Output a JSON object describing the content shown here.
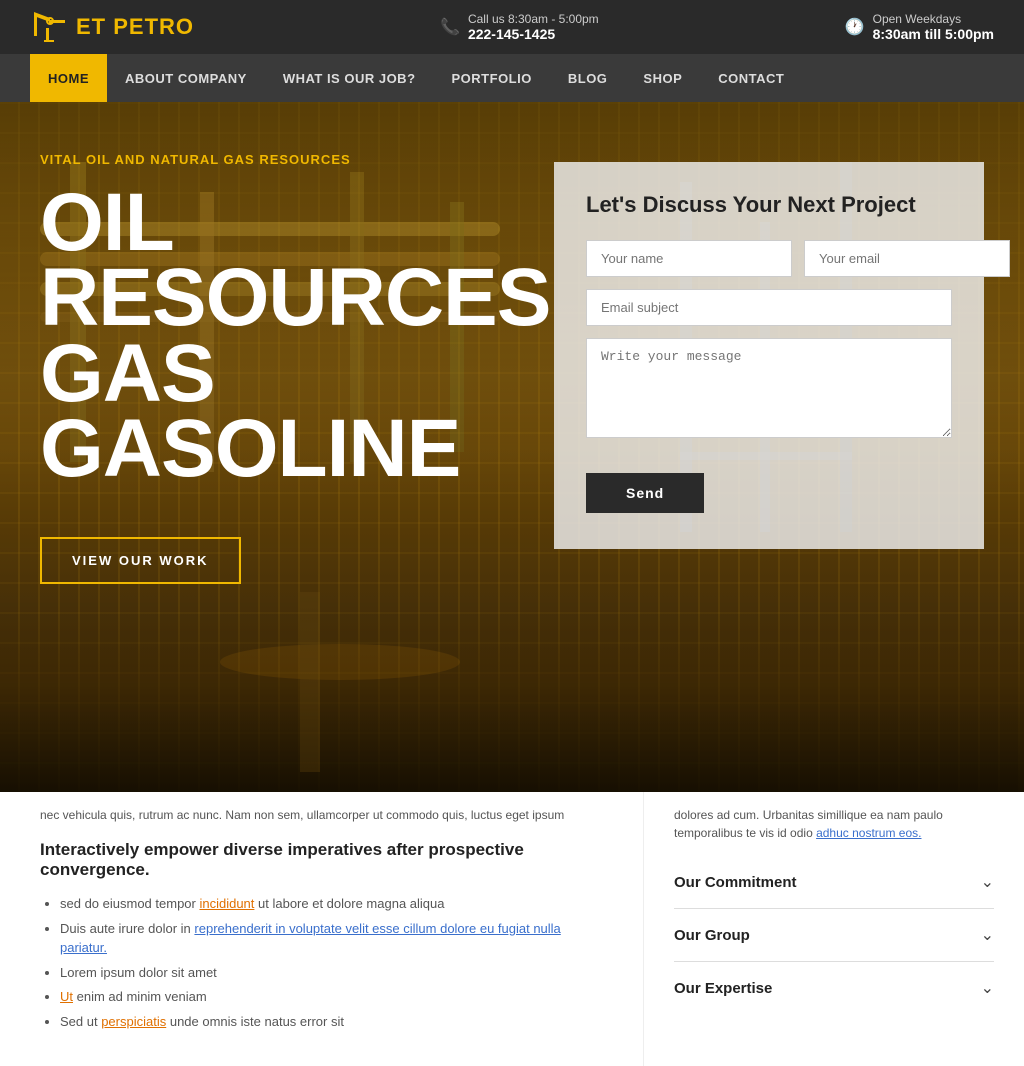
{
  "topbar": {
    "logo_prefix": "ET ",
    "logo_suffix": "PETRO",
    "call_label": "Call us 8:30am - 5:00pm",
    "phone": "222-145-1425",
    "hours_label": "Open Weekdays",
    "hours": "8:30am till 5:00pm"
  },
  "nav": {
    "items": [
      {
        "label": "HOME",
        "active": true
      },
      {
        "label": "ABOUT COMPANY",
        "active": false
      },
      {
        "label": "WHAT IS OUR JOB?",
        "active": false
      },
      {
        "label": "PORTFOLIO",
        "active": false
      },
      {
        "label": "BLOG",
        "active": false
      },
      {
        "label": "SHOP",
        "active": false
      },
      {
        "label": "CONTACT",
        "active": false
      }
    ]
  },
  "hero": {
    "subtitle": "VITAL OIL AND NATURAL GAS RESOURCES",
    "title_line1": "OIL",
    "title_line2": "RESOURCES",
    "title_line3": "GAS",
    "title_line4": "GASOLINE",
    "cta_label": "VIEW OUR WORK"
  },
  "contact_form": {
    "title": "Let's Discuss Your Next Project",
    "name_placeholder": "Your name",
    "email_placeholder": "Your email",
    "subject_placeholder": "Email subject",
    "message_placeholder": "Write your message",
    "send_label": "Send"
  },
  "lower_left": {
    "scroll_text": "nec vehicula quis, rutrum ac nunc. Nam non sem, ullamcorper ut commodo quis, luctus eget ipsum",
    "empower_heading": "Interactively empower diverse imperatives after prospective convergence.",
    "bullets": [
      {
        "text": "sed do eiusmod tempor incididunt ut labore et dolore magna aliqua",
        "highlight_word": "incididunt"
      },
      {
        "text": "Duis aute irure dolor in reprehenderit in voluptate velit esse cillum dolore eu fugiat nulla pariatur.",
        "highlight_words": [
          "reprehenderit",
          "in",
          "voluptate",
          "velit",
          "esse",
          "cillum",
          "dolore",
          "eu",
          "fugiat",
          "nulla",
          "pariatur"
        ]
      },
      {
        "text": "Lorem ipsum dolor sit amet"
      },
      {
        "text": "Ut enim ad minim veniam",
        "highlight_word": "Ut"
      },
      {
        "text": "Sed ut perspiciatis unde omnis iste natus error sit",
        "highlight_word": "perspiciatis"
      }
    ]
  },
  "lower_right": {
    "scroll_text": "dolores ad cum. Urbanitas simillique ea nam paulo temporalibus te vis id odio adhuc nostrum eos.",
    "link_text": "adhuc nostrum eos",
    "accordion": [
      {
        "label": "Our Commitment"
      },
      {
        "label": "Our Group"
      },
      {
        "label": "Our Expertise"
      }
    ]
  }
}
